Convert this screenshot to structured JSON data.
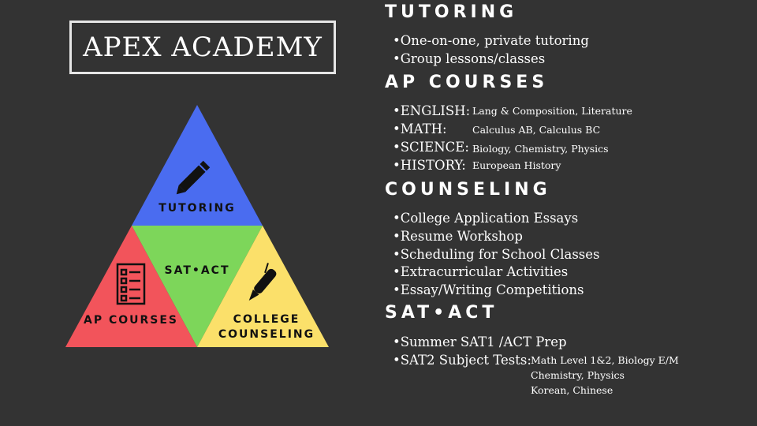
{
  "logo": {
    "text": "APEX ACADEMY"
  },
  "pyramid": {
    "top_label": "TUTORING",
    "center_label": "SAT•ACT",
    "left_label": "AP COURSES",
    "right_label_line1": "COLLEGE",
    "right_label_line2": "COUNSELING",
    "colors": {
      "top": "#4a6cf0",
      "center": "#7dd65a",
      "left": "#f2545b",
      "right": "#fbe06a"
    },
    "icons": [
      "pencil-icon",
      "document-list-icon",
      "pen-icon"
    ]
  },
  "tutoring": {
    "title": "TUTORING",
    "items": [
      "•One-on-one, private tutoring",
      "•Group lessons/classes"
    ]
  },
  "ap_courses": {
    "title": "AP COURSES",
    "rows": [
      {
        "subject": "•ENGLISH:",
        "detail": "Lang & Composition, Literature"
      },
      {
        "subject": "•MATH:",
        "detail": "Calculus AB, Calculus BC"
      },
      {
        "subject": "•SCIENCE:",
        "detail": "Biology, Chemistry, Physics"
      },
      {
        "subject": "•HISTORY:",
        "detail": "European History"
      }
    ]
  },
  "counseling": {
    "title": "COUNSELING",
    "items": [
      "•College Application Essays",
      "•Resume Workshop",
      "•Scheduling for School Classes",
      "•Extracurricular Activities",
      "•Essay/Writing Competitions"
    ]
  },
  "sat_act": {
    "title": "SAT•ACT",
    "item1": "•Summer SAT1 /ACT Prep",
    "item2": "•SAT2 Subject Tests:",
    "details": [
      "Math Level 1&2, Biology E/M",
      "Chemistry, Physics",
      "Korean, Chinese"
    ]
  }
}
